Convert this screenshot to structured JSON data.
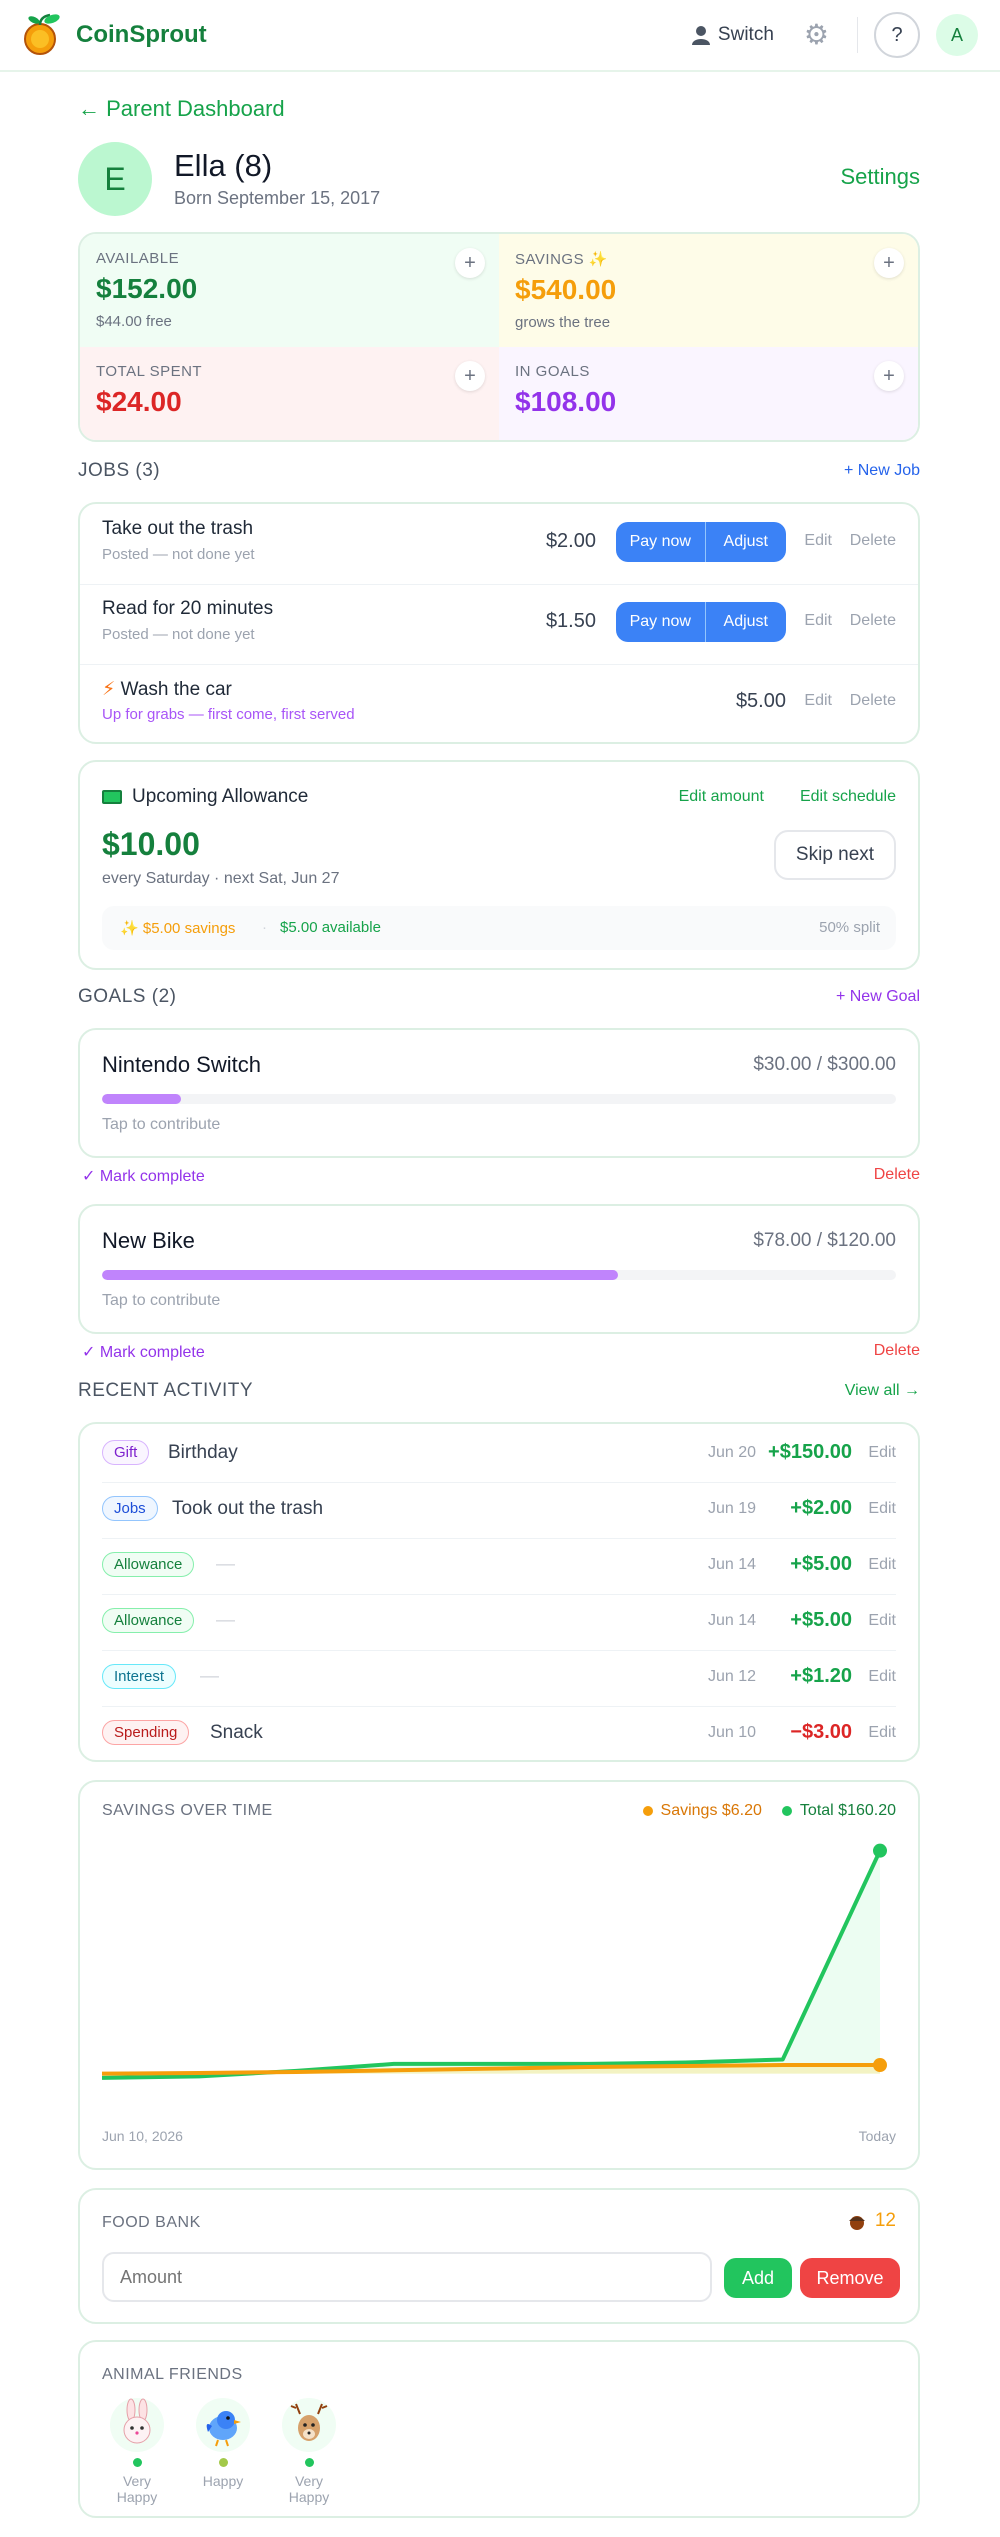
{
  "app": {
    "brand": "CoinSprout"
  },
  "topbar": {
    "switch_label": "Switch",
    "help_label": "?",
    "avatar_letter": "A"
  },
  "nav": {
    "back_label": "← Parent Dashboard",
    "settings_label": "Settings"
  },
  "profile": {
    "initial": "E",
    "name": "Ella (8)",
    "born": "Born September 15, 2017"
  },
  "stats": {
    "available": {
      "label": "AVAILABLE",
      "value": "$152.00",
      "sub": "$44.00 free"
    },
    "savings": {
      "label": "SAVINGS ✨",
      "value": "$540.00",
      "sub": "grows the tree"
    },
    "spent": {
      "label": "TOTAL SPENT",
      "value": "$24.00"
    },
    "goals": {
      "label": "IN GOALS",
      "value": "$108.00"
    }
  },
  "jobs": {
    "heading": "JOBS (3)",
    "new_label": "+ New Job",
    "items": [
      {
        "title": "Take out the trash",
        "status": "Posted — not done yet",
        "amount": "$2.00",
        "pay": "Pay now",
        "adjust": "Adjust",
        "edit": "Edit",
        "delete": "Delete"
      },
      {
        "title": "Read for 20 minutes",
        "status": "Posted — not done yet",
        "amount": "$1.50",
        "pay": "Pay now",
        "adjust": "Adjust",
        "edit": "Edit",
        "delete": "Delete"
      },
      {
        "title": "Wash the car",
        "status": "Up for grabs — first come, first served",
        "amount": "$5.00",
        "edit": "Edit",
        "delete": "Delete"
      }
    ]
  },
  "allowance": {
    "title": "Upcoming Allowance",
    "edit_amount": "Edit amount",
    "edit_schedule": "Edit schedule",
    "amount": "$10.00",
    "schedule": "every Saturday · next Sat, Jun 27",
    "skip": "Skip next",
    "savings_split": "$5.00 savings",
    "available_split": "$5.00 available",
    "split": "50% split"
  },
  "goals": {
    "heading": "GOALS (2)",
    "new_label": "+ New Goal",
    "items": [
      {
        "name": "Nintendo Switch",
        "progress": "$30.00 / $300.00",
        "fraction": 0.1,
        "tap": "Tap to contribute",
        "complete": "✓ Mark complete",
        "delete": "Delete"
      },
      {
        "name": "New Bike",
        "progress": "$78.00 / $120.00",
        "fraction": 0.65,
        "tap": "Tap to contribute",
        "complete": "✓ Mark complete",
        "delete": "Delete"
      }
    ]
  },
  "activity": {
    "heading": "RECENT ACTIVITY",
    "view_all": "View all →",
    "edit": "Edit",
    "rows": [
      {
        "tag": "Gift",
        "desc": "Birthday",
        "date": "Jun 20",
        "amount": "+$150.00"
      },
      {
        "tag": "Jobs",
        "desc": "Took out the trash",
        "date": "Jun 19",
        "amount": "+$2.00"
      },
      {
        "tag": "Allowance",
        "desc": "—",
        "date": "Jun 14",
        "amount": "+$5.00"
      },
      {
        "tag": "Allowance",
        "desc": "—",
        "date": "Jun 14",
        "amount": "+$5.00"
      },
      {
        "tag": "Interest",
        "desc": "—",
        "date": "Jun 12",
        "amount": "+$1.20"
      },
      {
        "tag": "Spending",
        "desc": "Snack",
        "date": "Jun 10",
        "amount": "−$3.00"
      }
    ]
  },
  "colors": {
    "green": "#16a34a",
    "orange": "#f59e0b",
    "purple": "#9333ea",
    "red": "#dc2626",
    "blue": "#3b82f6"
  },
  "chart_data": {
    "type": "line",
    "title": "SAVINGS OVER TIME",
    "x_labels": [
      "Jun 10, 2026",
      "Today"
    ],
    "series": [
      {
        "name": "Savings $6.20",
        "color": "#f59e0b",
        "values": [
          0,
          0.5,
          1.2,
          2.4,
          3.6,
          4.8,
          5.5,
          6.2,
          6.2
        ]
      },
      {
        "name": "Total $160.20",
        "color": "#22c55e",
        "values": [
          -3,
          -2,
          2,
          7,
          7,
          7,
          8,
          10.2,
          160.2
        ]
      }
    ],
    "x": [
      0,
      1,
      2,
      3,
      4,
      5,
      6,
      7,
      8
    ],
    "ylim": [
      -6,
      165
    ]
  },
  "foodbank": {
    "title": "FOOD BANK",
    "count": "12",
    "placeholder": "Amount",
    "add": "Add",
    "remove": "Remove"
  },
  "animals": {
    "title": "ANIMAL FRIENDS",
    "items": [
      {
        "name": "bunny",
        "status": "Very Happy",
        "dot": "#22c55e"
      },
      {
        "name": "bluebird",
        "status": "Happy",
        "dot": "#a3c94a"
      },
      {
        "name": "deer",
        "status": "Very Happy",
        "dot": "#22c55e"
      }
    ]
  }
}
